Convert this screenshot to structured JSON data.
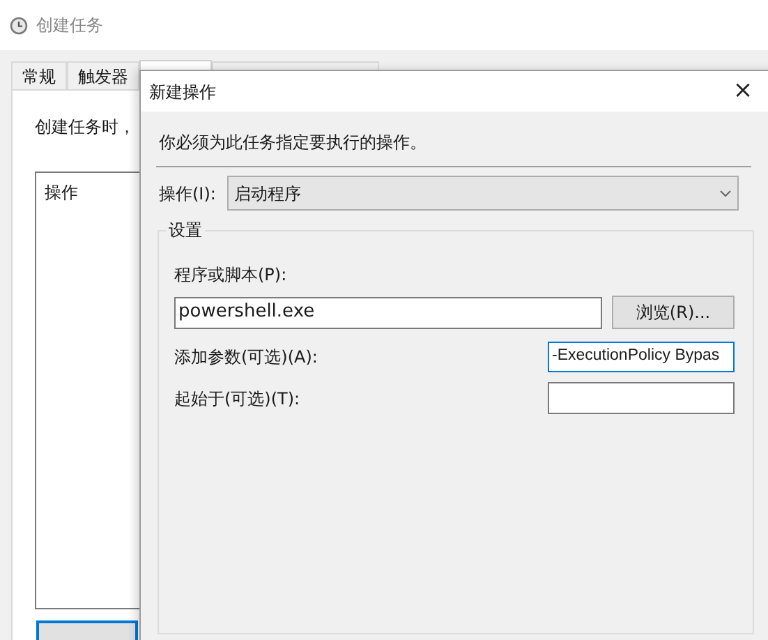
{
  "window": {
    "title": "创建任务"
  },
  "tabs": [
    {
      "label": "常规",
      "selected": false
    },
    {
      "label": "触发器",
      "selected": false
    },
    {
      "selected": true
    }
  ],
  "panel": {
    "intro": "创建任务时，",
    "list_header": "操作"
  },
  "dialog": {
    "title": "新建操作",
    "close": "×",
    "instruction": "你必须为此任务指定要执行的操作。",
    "action_label": "操作(I):",
    "action_value": "启动程序",
    "group_title": "设置",
    "program_label": "程序或脚本(P):",
    "program_value": "powershell.exe",
    "browse": "浏览(R)...",
    "args_label": "添加参数(可选)(A):",
    "args_value": "-ExecutionPolicy Bypas",
    "args_focused": true,
    "start_label": "起始于(可选)(T):",
    "start_focused": false
  }
}
